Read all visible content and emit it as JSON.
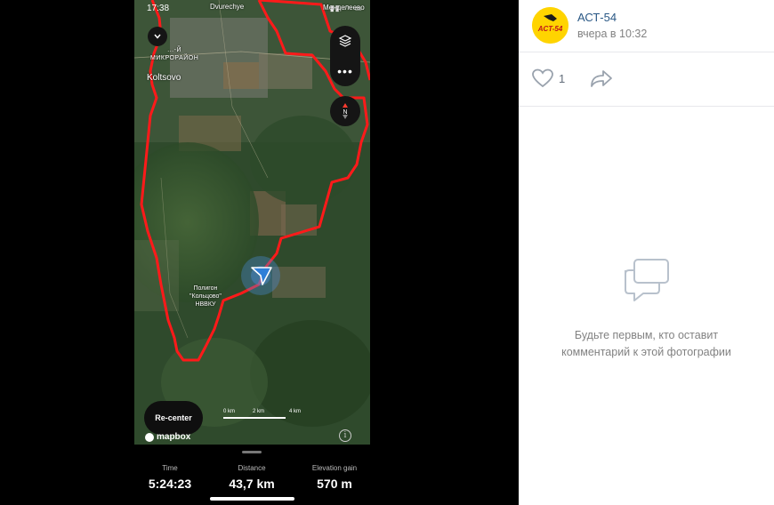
{
  "phone": {
    "status_time": "17:38",
    "status_icons": "▮▮ ◠ ▭"
  },
  "map": {
    "labels": {
      "dvurechye": "Dvurechye",
      "mendeleevo": "Менделеево",
      "mikrorayon_line1": "...-Й",
      "mikrorayon_line2": "МИКРОРАЙОН",
      "koltsovo": "Koltsovo",
      "poligon_line1": "Полигон",
      "poligon_line2": "\"Кольцово\"",
      "poligon_line3": "НВВКУ"
    },
    "scale_labels": [
      "0 km",
      "2 km",
      "4 km"
    ],
    "attribution": "mapbox",
    "route_color": "#ff1a1a"
  },
  "controls": {
    "recenter_label": "Re-center",
    "more_label": "•••",
    "collapse_icon": "chevron-down-icon",
    "layers_icon": "layers-icon",
    "compass_icon": "compass-icon",
    "compass_label": "N",
    "info_icon": "info-icon",
    "info_label": "i"
  },
  "stats": {
    "time_label": "Time",
    "time_value": "5:24:23",
    "distance_label": "Distance",
    "distance_value": "43,7 km",
    "elevation_label": "Elevation gain",
    "elevation_value": "570 m"
  },
  "post": {
    "author": "АСТ-54",
    "date": "вчера в 10:32",
    "avatar_text": "ACT-54",
    "avatar_color": "#ffd400",
    "like_count": "1",
    "like_icon": "heart-icon",
    "share_icon": "share-icon"
  },
  "comments": {
    "empty_icon": "chat-bubbles-icon",
    "empty_line1": "Будьте первым, кто оставит",
    "empty_line2": "комментарий к этой фотографии"
  }
}
